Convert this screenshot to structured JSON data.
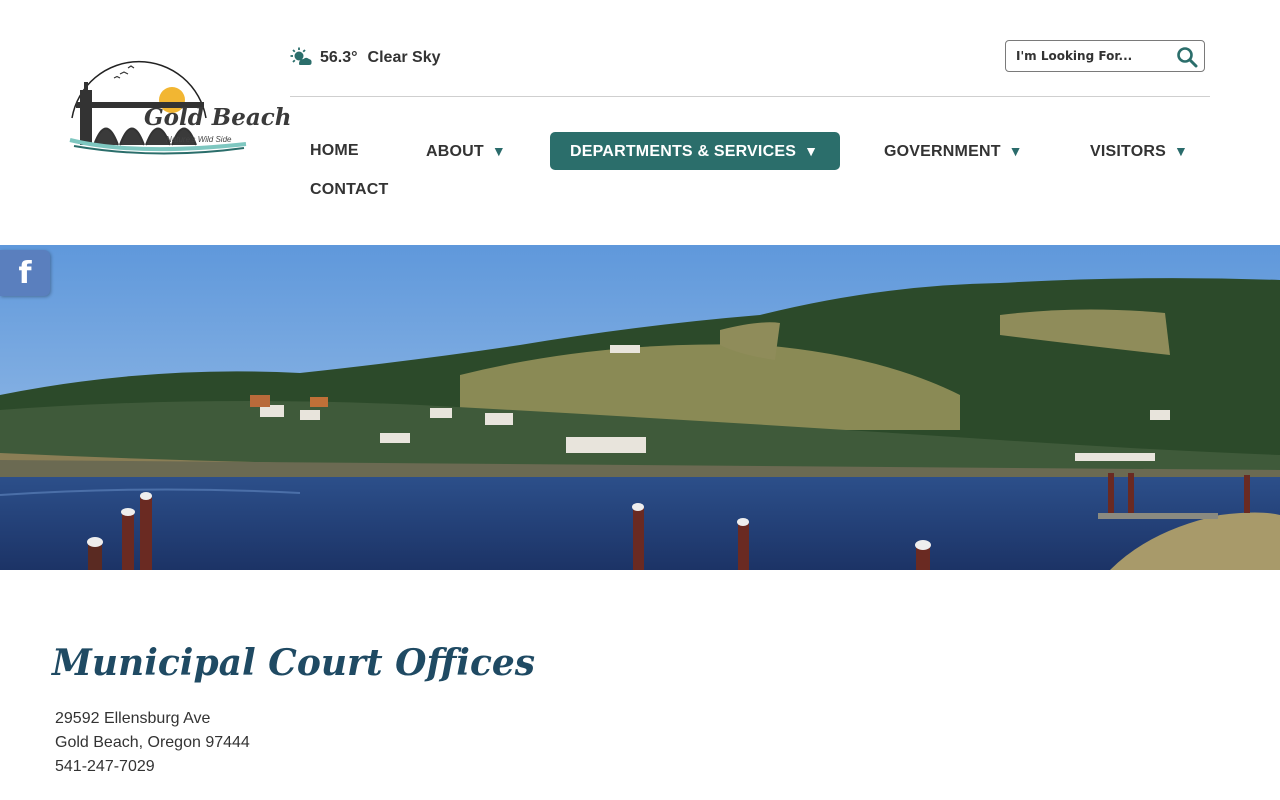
{
  "logo": {
    "title": "Gold Beach",
    "tagline": "Nature's Wild Side"
  },
  "weather": {
    "icon": "partly-sunny-icon",
    "temperature": "56.3°",
    "condition": "Clear Sky"
  },
  "search": {
    "placeholder": "I'm Looking For...",
    "icon": "search-icon"
  },
  "nav": {
    "items": [
      {
        "label": "HOME",
        "has_dropdown": false
      },
      {
        "label": "ABOUT",
        "has_dropdown": true
      },
      {
        "label": "DEPARTMENTS & SERVICES",
        "has_dropdown": true,
        "active": true
      },
      {
        "label": "GOVERNMENT",
        "has_dropdown": true
      },
      {
        "label": "VISITORS",
        "has_dropdown": true
      },
      {
        "label": "CONTACT",
        "has_dropdown": false
      }
    ],
    "caret": "▼"
  },
  "social": {
    "facebook_label": "f"
  },
  "page": {
    "title": "Municipal Court Offices",
    "address_line1": "29592 Ellensburg Ave",
    "address_line2": "Gold Beach, Oregon 97444",
    "phone": "541-247-7029"
  },
  "colors": {
    "accent": "#2b6e6b",
    "title": "#1f4a63",
    "facebook": "#5a7fbe"
  }
}
